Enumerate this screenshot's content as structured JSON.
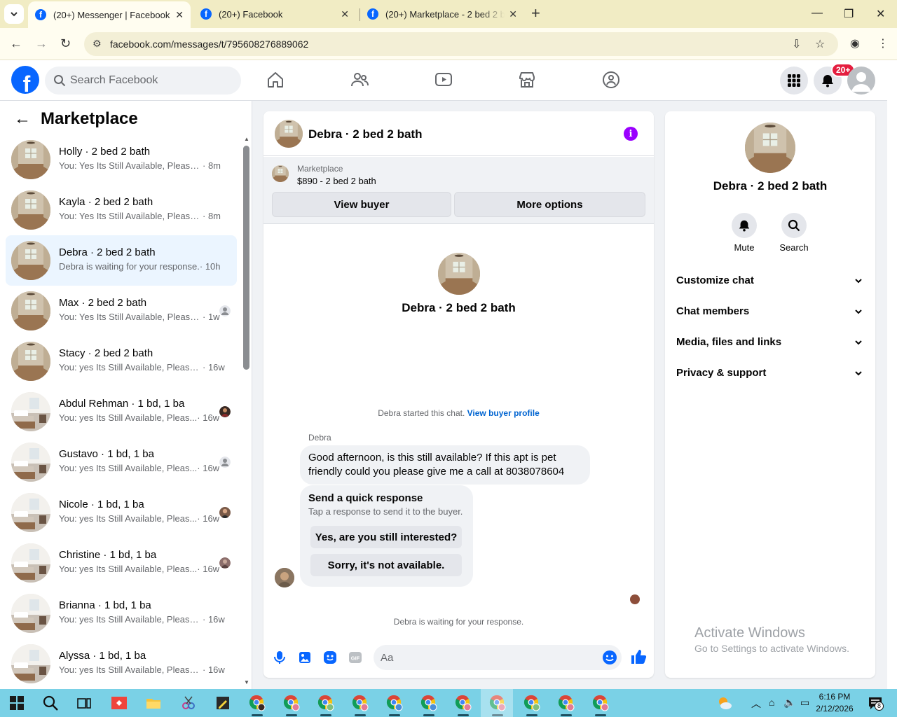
{
  "browser": {
    "tabs": [
      {
        "title": "(20+) Messenger | Facebook",
        "active": true
      },
      {
        "title": "(20+) Facebook",
        "active": false
      },
      {
        "title": "(20+) Marketplace - 2 bed 2 bath",
        "active": false
      }
    ],
    "url": "facebook.com/messages/t/795608276889062"
  },
  "header": {
    "search_placeholder": "Search Facebook",
    "notifications_badge": "20+"
  },
  "sidebar": {
    "title": "Marketplace",
    "conversations": [
      {
        "name": "Holly · 2 bed 2 bath",
        "preview": "You: Yes Its Still Available, Please S...",
        "time": "· 8m",
        "thumb": "room"
      },
      {
        "name": "Kayla · 2 bed 2 bath",
        "preview": "You: Yes Its Still Available, Please S...",
        "time": "· 8m",
        "thumb": "room"
      },
      {
        "name": "Debra · 2 bed 2 bath",
        "preview": "Debra is waiting for your response.",
        "time": "· 10h",
        "thumb": "room",
        "active": true
      },
      {
        "name": "Max · 2 bed 2 bath",
        "preview": "You: Yes Its Still Available, Please...",
        "time": "· 1w",
        "thumb": "room"
      },
      {
        "name": "Stacy · 2 bed 2 bath",
        "preview": "You: yes Its Still Available, Please ...",
        "time": "· 16w",
        "thumb": "room"
      },
      {
        "name": "Abdul Rehman · 1 bd, 1 ba",
        "preview": "You: yes Its Still Available, Pleas...",
        "time": "· 16w",
        "thumb": "bedroom"
      },
      {
        "name": "Gustavo · 1 bd, 1 ba",
        "preview": "You: yes Its Still Available, Pleas...",
        "time": "· 16w",
        "thumb": "bedroom"
      },
      {
        "name": "Nicole · 1 bd, 1 ba",
        "preview": "You: yes Its Still Available, Pleas...",
        "time": "· 16w",
        "thumb": "bedroom"
      },
      {
        "name": "Christine · 1 bd, 1 ba",
        "preview": "You: yes Its Still Available, Pleas...",
        "time": "· 16w",
        "thumb": "bedroom"
      },
      {
        "name": "Brianna · 1 bd, 1 ba",
        "preview": "You: yes Its Still Available, Please ...",
        "time": "· 16w",
        "thumb": "bedroom"
      },
      {
        "name": "Alyssa · 1 bd, 1 ba",
        "preview": "You: yes Its Still Available, Please ...",
        "time": "· 16w",
        "thumb": "bedroom"
      }
    ]
  },
  "chat": {
    "title": "Debra · 2 bed 2 bath",
    "marketplace_label": "Marketplace",
    "listing": "$890 - 2 bed 2 bath",
    "view_buyer": "View buyer",
    "more_options": "More options",
    "hero_name": "Debra · 2 bed 2 bath",
    "started_text": "Debra started this chat.",
    "view_buyer_profile": "View buyer profile",
    "sender": "Debra",
    "message": "Good afternoon, is this still available? If this apt is pet friendly could you please give me a call at  8038078604",
    "quick_title": "Send a quick response",
    "quick_desc": "Tap a response to send it to the buyer.",
    "quick_1": "Yes, are you still interested?",
    "quick_2": "Sorry, it's not available.",
    "waiting": "Debra is waiting for your response.",
    "composer_placeholder": "Aa"
  },
  "details": {
    "name": "Debra · 2 bed 2 bath",
    "mute": "Mute",
    "search": "Search",
    "sections": [
      "Customize chat",
      "Chat members",
      "Media, files and links",
      "Privacy & support"
    ]
  },
  "watermark": {
    "line1": "Activate Windows",
    "line2": "Go to Settings to activate Windows."
  },
  "taskbar": {
    "time": "6:16 PM",
    "date": "2/12/2026",
    "notif_count": "8"
  },
  "colors": {
    "brand": "#0866ff",
    "active_row": "#ebf5ff",
    "info": "#9a00ff",
    "badge": "#e41e3f",
    "taskbar": "#7ad1e6"
  }
}
